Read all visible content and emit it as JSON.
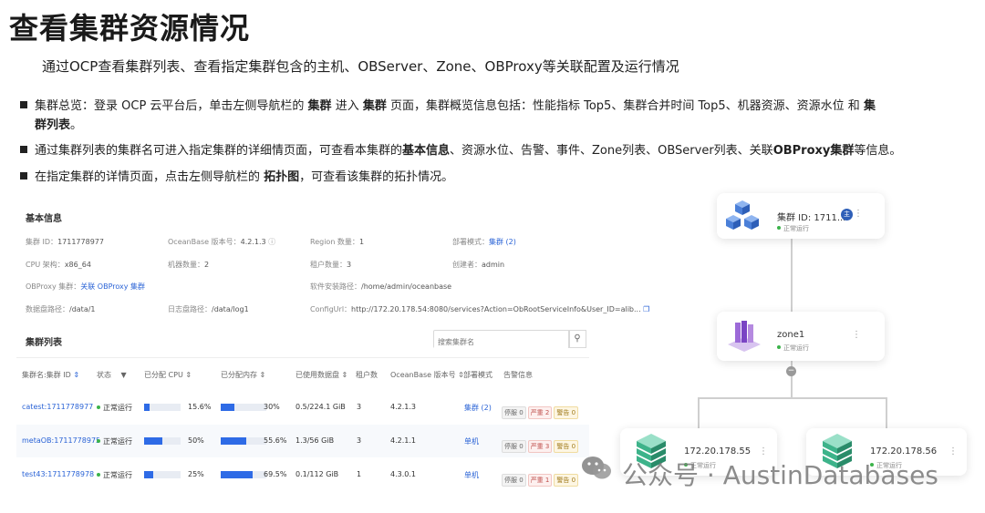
{
  "title": "查看集群资源情况",
  "subtitle": "通过OCP查看集群列表、查看指定集群包含的主机、OBServer、Zone、OBProxy等关联配置及运行情况",
  "bullets": {
    "b1_a": "集群总览：登录 OCP 云平台后，单击左侧导航栏的 ",
    "b1_b": "集群",
    "b1_c": " 进入 ",
    "b1_d": "集群",
    "b1_e": " 页面，集群概览信息包括：性能指标 Top5、集群合并时间 Top5、机器资源、资源水位 和 ",
    "b1_f": "集",
    "b1_g": "群列表",
    "b1_h": "。",
    "b2_a": "通过集群列表的集群名可进入指定集群的详细情页面，可查看本集群的",
    "b2_b": "基本信息",
    "b2_c": "、资源水位、告警、事件、Zone列表、OBServer列表、关联",
    "b2_d": "OBProxy集群",
    "b2_e": "等信息。",
    "b3_a": "在指定集群的详情页面，点击左侧导航栏的 ",
    "b3_b": "拓扑图",
    "b3_c": "，可查看该集群的拓扑情况。"
  },
  "basic_info": {
    "section_title": "基本信息",
    "cluster_id_label": "集群 ID：",
    "cluster_id": "1711778977",
    "ob_version_label": "OceanBase 版本号：",
    "ob_version": "4.2.1.3",
    "region_label": "Region 数量：",
    "region": "1",
    "deploy_label": "部署模式：",
    "deploy": "集群 (2)",
    "cpu_arch_label": "CPU 架构：",
    "cpu_arch": "x86_64",
    "machines_label": "机器数量：",
    "machines": "2",
    "tenants_label": "租户数量：",
    "tenants": "3",
    "creator_label": "创建者：",
    "creator": "admin",
    "obproxy_label": "OBProxy 集群：",
    "obproxy": "关联 OBProxy 集群",
    "install_path_label": "软件安装路径：",
    "install_path": "/home/admin/oceanbase",
    "data_path_label": "数据盘路径：",
    "data_path": "/data/1",
    "log_path_label": "日志盘路径：",
    "log_path": "/data/log1",
    "config_url_label": "ConfigUrl：",
    "config_url": "http://172.20.178.54:8080/services?Action=ObRootServiceInfo&User_ID=alib..."
  },
  "cluster_list": {
    "section_title": "集群列表",
    "search_placeholder": "搜索集群名",
    "headers": [
      "集群名:集群 ID",
      "状态",
      "已分配 CPU",
      "已分配内存",
      "已使用数据盘",
      "租户数",
      "OceanBase 版本号",
      "部署模式",
      "告警信息"
    ],
    "rows": [
      {
        "name": "catest:1711778977",
        "status": "正常运行",
        "cpu": "15.6%",
        "cpu_frac": 0.156,
        "mem": "30%",
        "mem_frac": 0.3,
        "disk": "0.5/224.1 GiB",
        "tenants": "3",
        "version": "4.2.1.3",
        "mode": "集群 (2)",
        "t1": "停服 0",
        "t2": "严重 2",
        "t3": "警告 0"
      },
      {
        "name": "metaOB:1711778975",
        "status": "正常运行",
        "cpu": "50%",
        "cpu_frac": 0.5,
        "mem": "55.6%",
        "mem_frac": 0.556,
        "disk": "1.3/56 GiB",
        "tenants": "3",
        "version": "4.2.1.1",
        "mode": "单机",
        "t1": "停服 0",
        "t2": "严重 3",
        "t3": "警告 0"
      },
      {
        "name": "test43:1711778978",
        "status": "正常运行",
        "cpu": "25%",
        "cpu_frac": 0.25,
        "mem": "69.5%",
        "mem_frac": 0.695,
        "disk": "0.1/112 GiB",
        "tenants": "1",
        "version": "4.3.0.1",
        "mode": "单机",
        "t1": "停服 0",
        "t2": "严重 1",
        "t3": "警告 0"
      }
    ]
  },
  "topology": {
    "cluster_node": "集群 ID: 1711...",
    "cluster_badge": "主",
    "cluster_status": "正常运行",
    "zone_node": "zone1",
    "zone_status": "正常运行",
    "server1": "172.20.178.55",
    "server1_status": "正常运行",
    "server2": "172.20.178.56",
    "server2_status": "正常运行"
  },
  "watermark": "公众号 · AustinDatabases",
  "colors": {
    "accent": "#2e6be6",
    "ok": "#3bb34a"
  }
}
